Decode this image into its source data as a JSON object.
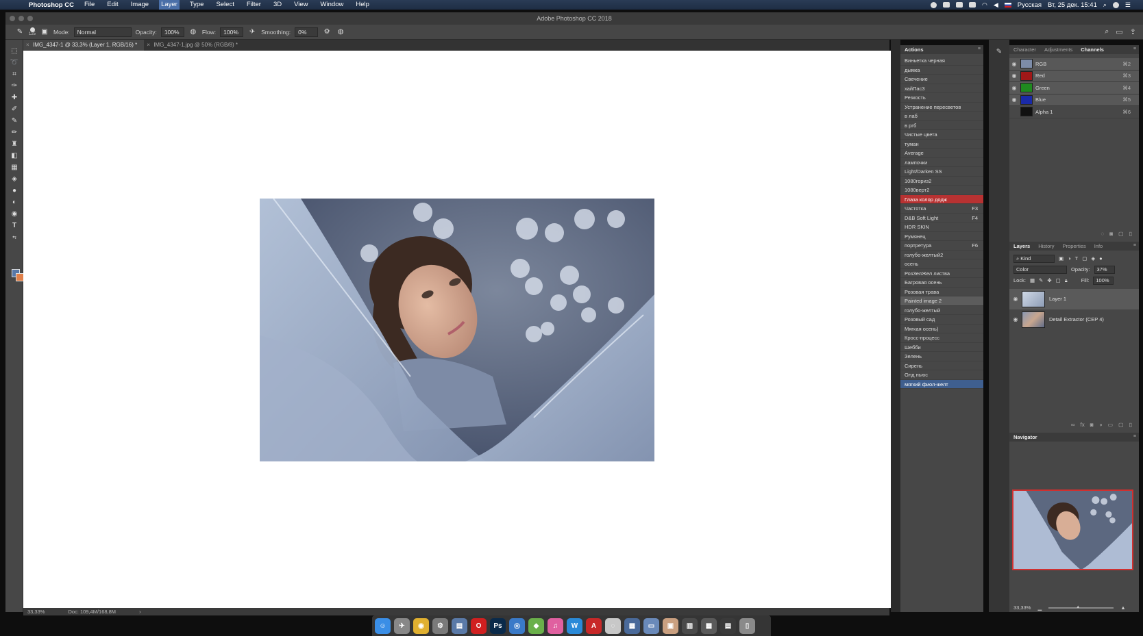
{
  "menubar": {
    "app_name": "Photoshop CC",
    "items": [
      "File",
      "Edit",
      "Image",
      "Layer",
      "Type",
      "Select",
      "Filter",
      "3D",
      "View",
      "Window",
      "Help"
    ],
    "active_item": "Layer",
    "keyboard_layout": "Русская",
    "datetime": "Вт, 25 дек. 15:41"
  },
  "window": {
    "title": "Adobe Photoshop CC 2018"
  },
  "options_bar": {
    "brush_size": "125",
    "mode_label": "Mode:",
    "mode_value": "Normal",
    "opacity_label": "Opacity:",
    "opacity_value": "100%",
    "flow_label": "Flow:",
    "flow_value": "100%",
    "smoothing_label": "Smoothing:",
    "smoothing_value": "0%"
  },
  "document_tabs": [
    {
      "label": "IMG_4347-1 @ 33,3% (Layer 1, RGB/16) *",
      "active": true
    },
    {
      "label": "IMG_4347-1.jpg @ 50% (RGB/8) *",
      "active": false
    }
  ],
  "status_bar": {
    "zoom": "33,33%",
    "doc": "Doc: 109,4M/168,8M"
  },
  "actions_panel": {
    "title": "Actions",
    "items": [
      {
        "label": "Виньетка черная",
        "key": "",
        "state": ""
      },
      {
        "label": "дымка",
        "key": "",
        "state": ""
      },
      {
        "label": "Свечение",
        "key": "",
        "state": ""
      },
      {
        "label": "хайПас3",
        "key": "",
        "state": ""
      },
      {
        "label": "Резкость",
        "key": "",
        "state": ""
      },
      {
        "label": "Устранение пересветов",
        "key": "",
        "state": ""
      },
      {
        "label": "в лаб",
        "key": "",
        "state": ""
      },
      {
        "label": "в ргб",
        "key": "",
        "state": ""
      },
      {
        "label": "Чистые цвета",
        "key": "",
        "state": ""
      },
      {
        "label": "туман",
        "key": "",
        "state": ""
      },
      {
        "label": "Average",
        "key": "",
        "state": ""
      },
      {
        "label": "лампочки",
        "key": "",
        "state": ""
      },
      {
        "label": "Light/Darken SS",
        "key": "",
        "state": ""
      },
      {
        "label": "1080гориз2",
        "key": "",
        "state": ""
      },
      {
        "label": "1080верт2",
        "key": "",
        "state": ""
      },
      {
        "label": "Глаза колор додж",
        "key": "",
        "state": "red"
      },
      {
        "label": "Частотка",
        "key": "F3",
        "state": ""
      },
      {
        "label": "D&B Soft Light",
        "key": "F4",
        "state": ""
      },
      {
        "label": "HDR SKIN",
        "key": "",
        "state": ""
      },
      {
        "label": "Румянец",
        "key": "",
        "state": ""
      },
      {
        "label": "портретура",
        "key": "F6",
        "state": ""
      },
      {
        "label": "голубо-желтый2",
        "key": "",
        "state": ""
      },
      {
        "label": "осень",
        "key": "",
        "state": ""
      },
      {
        "label": "РозЗелЖел листва",
        "key": "",
        "state": ""
      },
      {
        "label": "Багровая осень",
        "key": "",
        "state": ""
      },
      {
        "label": "Розовая трава",
        "key": "",
        "state": ""
      },
      {
        "label": "Painted image 2",
        "key": "",
        "state": "grey"
      },
      {
        "label": "голубо-желтый",
        "key": "",
        "state": ""
      },
      {
        "label": "Розовый сад",
        "key": "",
        "state": ""
      },
      {
        "label": "Мягкая осень)",
        "key": "",
        "state": ""
      },
      {
        "label": "Кросс-процесс",
        "key": "",
        "state": ""
      },
      {
        "label": "Шебби",
        "key": "",
        "state": ""
      },
      {
        "label": "Зелень",
        "key": "",
        "state": ""
      },
      {
        "label": "Сирень",
        "key": "",
        "state": ""
      },
      {
        "label": "Олд ньюс",
        "key": "",
        "state": ""
      },
      {
        "label": "мягкий фиол-желт",
        "key": "",
        "state": "blue"
      }
    ]
  },
  "channels_panel": {
    "tabs": [
      "Character",
      "Adjustments",
      "Channels"
    ],
    "active_tab": "Channels",
    "channels": [
      {
        "name": "RGB",
        "shortcut": "⌘2",
        "color": "#7d8ca8",
        "visible": true
      },
      {
        "name": "Red",
        "shortcut": "⌘3",
        "color": "#a01818",
        "visible": true
      },
      {
        "name": "Green",
        "shortcut": "⌘4",
        "color": "#1f8a1f",
        "visible": true
      },
      {
        "name": "Blue",
        "shortcut": "⌘5",
        "color": "#1a2aa8",
        "visible": true
      },
      {
        "name": "Alpha 1",
        "shortcut": "⌘6",
        "color": "#111111",
        "visible": false
      }
    ]
  },
  "layers_panel": {
    "tabs": [
      "Layers",
      "History",
      "Properties",
      "Info"
    ],
    "active_tab": "Layers",
    "kind_label": "Kind",
    "blend_mode": "Color",
    "opacity_label": "Opacity:",
    "opacity_value": "37%",
    "lock_label": "Lock:",
    "fill_label": "Fill:",
    "fill_value": "100%",
    "layers": [
      {
        "name": "Layer 1",
        "selected": true
      },
      {
        "name": "Detail Extractor  (CEP 4)",
        "selected": false
      }
    ]
  },
  "navigator_panel": {
    "title": "Navigator",
    "zoom": "33,33%"
  },
  "dock": {
    "apps": [
      {
        "icon": "finder-icon",
        "color": "#3a8ee6",
        "glyph": "☺"
      },
      {
        "icon": "launchpad-icon",
        "color": "#888888",
        "glyph": "✈"
      },
      {
        "icon": "chrome-icon",
        "color": "#e0b030",
        "glyph": "◉"
      },
      {
        "icon": "system-prefs-icon",
        "color": "#7a7a7a",
        "glyph": "⚙"
      },
      {
        "icon": "finder-folder-icon",
        "color": "#5a7aa8",
        "glyph": "▤"
      },
      {
        "icon": "opera-icon",
        "color": "#d02020",
        "glyph": "O"
      },
      {
        "icon": "photoshop-icon",
        "color": "#0a2a4a",
        "glyph": "Ps"
      },
      {
        "icon": "safari-icon",
        "color": "#3a7ac8",
        "glyph": "◎"
      },
      {
        "icon": "maps-icon",
        "color": "#6ab04a",
        "glyph": "◆"
      },
      {
        "icon": "itunes-icon",
        "color": "#e060a0",
        "glyph": "♫"
      },
      {
        "icon": "word-icon",
        "color": "#2a8ad8",
        "glyph": "W"
      },
      {
        "icon": "acrobat-icon",
        "color": "#c82828",
        "glyph": "A"
      },
      {
        "icon": "capture-icon",
        "color": "#c8c8c8",
        "glyph": "◌"
      },
      {
        "icon": "folder-stack-icon",
        "color": "#4a6a9a",
        "glyph": "▦"
      },
      {
        "icon": "screenshot-icon",
        "color": "#6a8aba",
        "glyph": "▭"
      },
      {
        "icon": "preview-icon",
        "color": "#caa080",
        "glyph": "▣"
      },
      {
        "icon": "photos-stack-icon",
        "color": "#4a4a4a",
        "glyph": "▥"
      },
      {
        "icon": "grid-icon",
        "color": "#5a5a5a",
        "glyph": "▦"
      },
      {
        "icon": "downloads-icon",
        "color": "#3a3a3a",
        "glyph": "▤"
      },
      {
        "icon": "trash-icon",
        "color": "#8a8a8a",
        "glyph": "▯"
      }
    ]
  }
}
